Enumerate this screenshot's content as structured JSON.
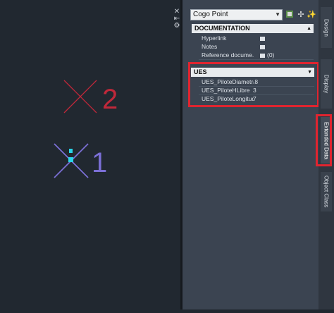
{
  "toolbar": {
    "object_type": "Cogo Point"
  },
  "sections": {
    "documentation": {
      "title": "DOCUMENTATION",
      "rows": [
        {
          "name": "Hyperlink",
          "value": ""
        },
        {
          "name": "Notes",
          "value": ""
        },
        {
          "name": "Reference docume...",
          "value": "(0)"
        }
      ]
    },
    "ues": {
      "title": "UES",
      "rows": [
        {
          "name": "UES_PiloteDiametro",
          "value": ".8"
        },
        {
          "name": "UES_PiloteHLibre",
          "value": "3"
        },
        {
          "name": "UES_PiloteLongitud",
          "value": "7"
        }
      ]
    }
  },
  "tabs": [
    {
      "label": "Design",
      "active": false
    },
    {
      "label": "Display",
      "active": false
    },
    {
      "label": "Extended Data",
      "active": true
    },
    {
      "label": "Object Class",
      "active": false
    }
  ],
  "drawing": {
    "points": [
      {
        "label": "2",
        "color": "#c0283a",
        "selected": false
      },
      {
        "label": "1",
        "color": "#7b6fd6",
        "selected": true
      }
    ],
    "grip_color": "#29d4e8"
  },
  "colors": {
    "canvas": "#212830",
    "panel": "#3b4451",
    "highlight": "#e0242f"
  }
}
